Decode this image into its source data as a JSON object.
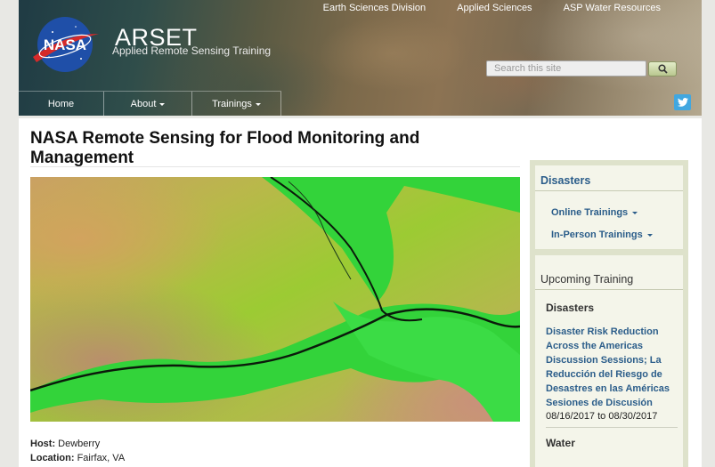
{
  "top_nav": [
    "Earth Sciences Division",
    "Applied Sciences",
    "ASP Water Resources"
  ],
  "site": {
    "logo_text": "NASA",
    "name": "ARSET",
    "slogan": "Applied Remote Sensing Training"
  },
  "search": {
    "placeholder": "Search this site"
  },
  "main_nav": [
    {
      "label": "Home",
      "has_dropdown": false
    },
    {
      "label": "About",
      "has_dropdown": true
    },
    {
      "label": "Trainings",
      "has_dropdown": true
    }
  ],
  "social": {
    "twitter_icon": "twitter-icon"
  },
  "page": {
    "title": "NASA Remote Sensing for Flood Monitoring and Management",
    "host_label": "Host:",
    "host_value": "Dewberry",
    "location_label": "Location:",
    "location_value": "Fairfax, VA"
  },
  "sidebar": {
    "disasters_block": {
      "title": "Disasters",
      "links": [
        "Online Trainings",
        "In-Person Trainings"
      ]
    },
    "upcoming_block": {
      "title": "Upcoming Training",
      "category1": "Disasters",
      "event_title": "Disaster Risk Reduction Across the Americas Discussion Sessions; La Reducción del Riesgo de Desastres en las Américas Sesiones de Discusión",
      "event_dates": "08/16/2017 to 08/30/2017",
      "category2": "Water"
    }
  },
  "colors": {
    "link": "#2b5d8a",
    "sidebar_bg": "#dee2cb",
    "search_button": "#c6d29e",
    "twitter": "#41a7e0"
  }
}
